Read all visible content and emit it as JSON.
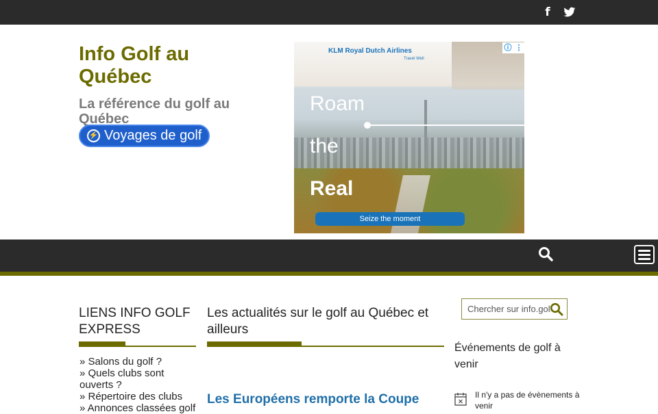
{
  "topbar": {
    "facebook_icon": "facebook-icon",
    "twitter_icon": "twitter-icon",
    "facebook_glyph": "f",
    "twitter_glyph": "🐦"
  },
  "header": {
    "title": "Info Golf au Québec",
    "tagline": "La référence du golf au Québec",
    "voyages_button": "Voyages de golf"
  },
  "ad": {
    "brand": "KLM Royal Dutch Airlines",
    "brand_sub": "Travel Well",
    "headline_1": "Roam",
    "headline_2": "the",
    "headline_3": "Real",
    "cta": "Seize the moment"
  },
  "left": {
    "title": "LIENS INFO GOLF EXPRESS",
    "links": [
      "» Salons du golf ?",
      "» Quels clubs sont ouverts ?",
      "» Répertoire des clubs",
      "» Annonces classées golf"
    ]
  },
  "center": {
    "title": "Les actualités sur le golf au Québec et ailleurs",
    "article_title": "Les Européens remporte la Coupe"
  },
  "right": {
    "search_placeholder": "Chercher sur info.golf",
    "events_title": "Événements de golf à venir",
    "events_empty": "Il n'y a pas de évènements à venir"
  },
  "colors": {
    "accent": "#6b6b00",
    "dark_bar": "#2b2b2b",
    "link_blue": "#1f6fa8",
    "button_blue": "#1f5fcc"
  }
}
